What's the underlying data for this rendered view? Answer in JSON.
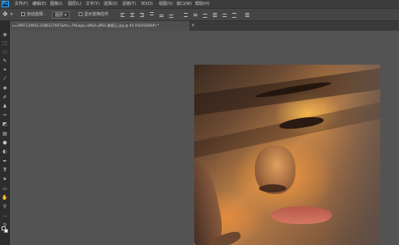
{
  "app": {
    "logo": "Ps"
  },
  "menu": [
    "文件(F)",
    "编辑(E)",
    "图像(I)",
    "图层(L)",
    "文字(Y)",
    "选择(S)",
    "滤镜(T)",
    "3D(D)",
    "视图(V)",
    "窗口(W)",
    "帮助(H)"
  ],
  "options": {
    "auto_select_label": "自动选择：",
    "auto_select_value": "图层",
    "show_transform_label": "显示变换控件"
  },
  "document": {
    "tab_title": "u=2997234663,1586327667&fm=79&app=86&f=JPEG.看图王.jpg @ 45.5%(RGB/8#) *",
    "close": "×"
  },
  "tools": [
    "move-tool",
    "marquee-tool",
    "lasso-tool",
    "quick-select-tool",
    "crop-tool",
    "eyedropper-tool",
    "healing-brush-tool",
    "brush-tool",
    "clone-stamp-tool",
    "history-brush-tool",
    "eraser-tool",
    "gradient-tool",
    "blur-tool",
    "dodge-tool",
    "pen-tool",
    "type-tool",
    "path-select-tool",
    "rectangle-tool",
    "hand-tool",
    "zoom-tool",
    "more-tools"
  ],
  "colors": {
    "foreground": "#111111",
    "background": "#ffffff",
    "accent": "#31a8ff"
  }
}
